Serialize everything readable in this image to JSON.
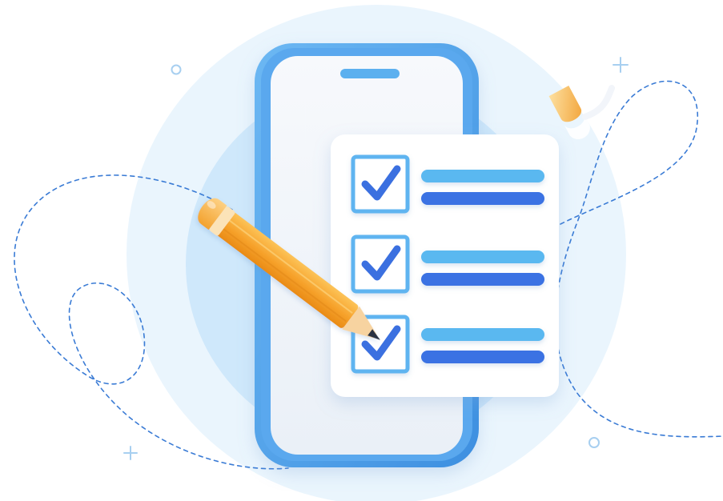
{
  "illustration": {
    "checklist": {
      "items": [
        {
          "checked": true
        },
        {
          "checked": true
        },
        {
          "checked": true
        }
      ]
    },
    "colors": {
      "background": "#ffffff",
      "outer_circle": "#eaf5fd",
      "inner_circle": "#cfe8fb",
      "phone_frame": "#4a9ee8",
      "phone_screen": "#f5f8fc",
      "card": "#ffffff",
      "checkbox_border": "#5fb4f0",
      "checkmark": "#3a6fe0",
      "line_light": "#5ab8f0",
      "line_dark": "#3a72e3",
      "pencil_body": "#f6a62b",
      "pencil_band": "#fbe3b8",
      "pencil_eraser": "#f8b447",
      "dashed_line": "#3a7bd5",
      "sparkle": "#a7cff0"
    },
    "icons": [
      "phone-icon",
      "checklist-icon",
      "pencil-icon",
      "checkmark-icon",
      "pen-nib-icon"
    ]
  }
}
